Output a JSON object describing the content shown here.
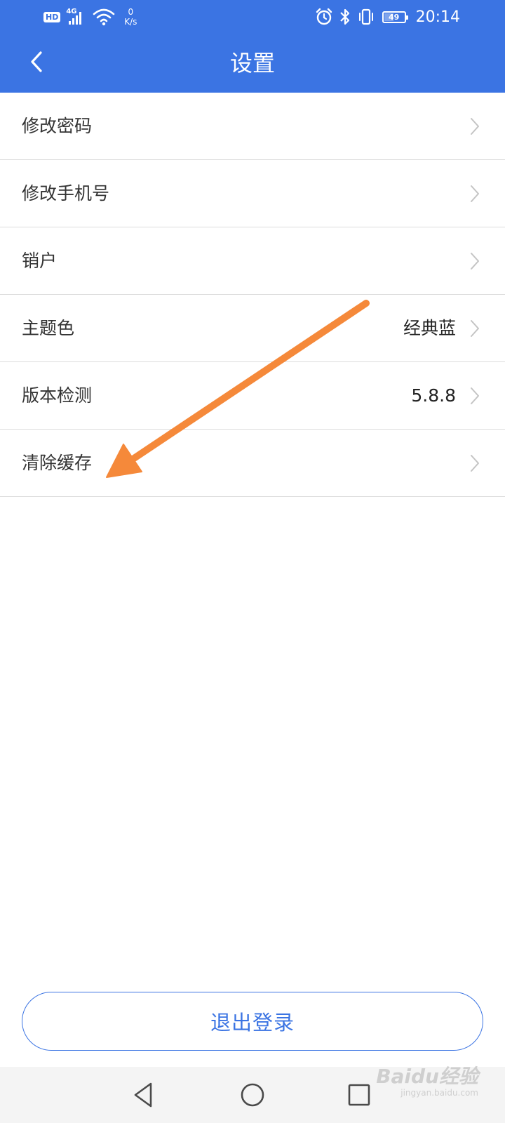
{
  "status_bar": {
    "hd": "HD",
    "network": "4G",
    "speed_value": "0",
    "speed_unit": "K/s",
    "battery": "49",
    "battery_level": 0.49,
    "time": "20:14"
  },
  "header": {
    "title": "设置"
  },
  "settings": {
    "items": [
      {
        "label": "修改密码",
        "value": ""
      },
      {
        "label": "修改手机号",
        "value": ""
      },
      {
        "label": "销户",
        "value": ""
      },
      {
        "label": "主题色",
        "value": "经典蓝"
      },
      {
        "label": "版本检测",
        "value": "5.8.8"
      },
      {
        "label": "清除缓存",
        "value": ""
      }
    ]
  },
  "logout": {
    "label": "退出登录"
  },
  "annotation": {
    "color": "#f5893a"
  },
  "watermark": {
    "main": "Baidu经验",
    "sub": "jingyan.baidu.com"
  },
  "colors": {
    "primary": "#3b74e3"
  }
}
